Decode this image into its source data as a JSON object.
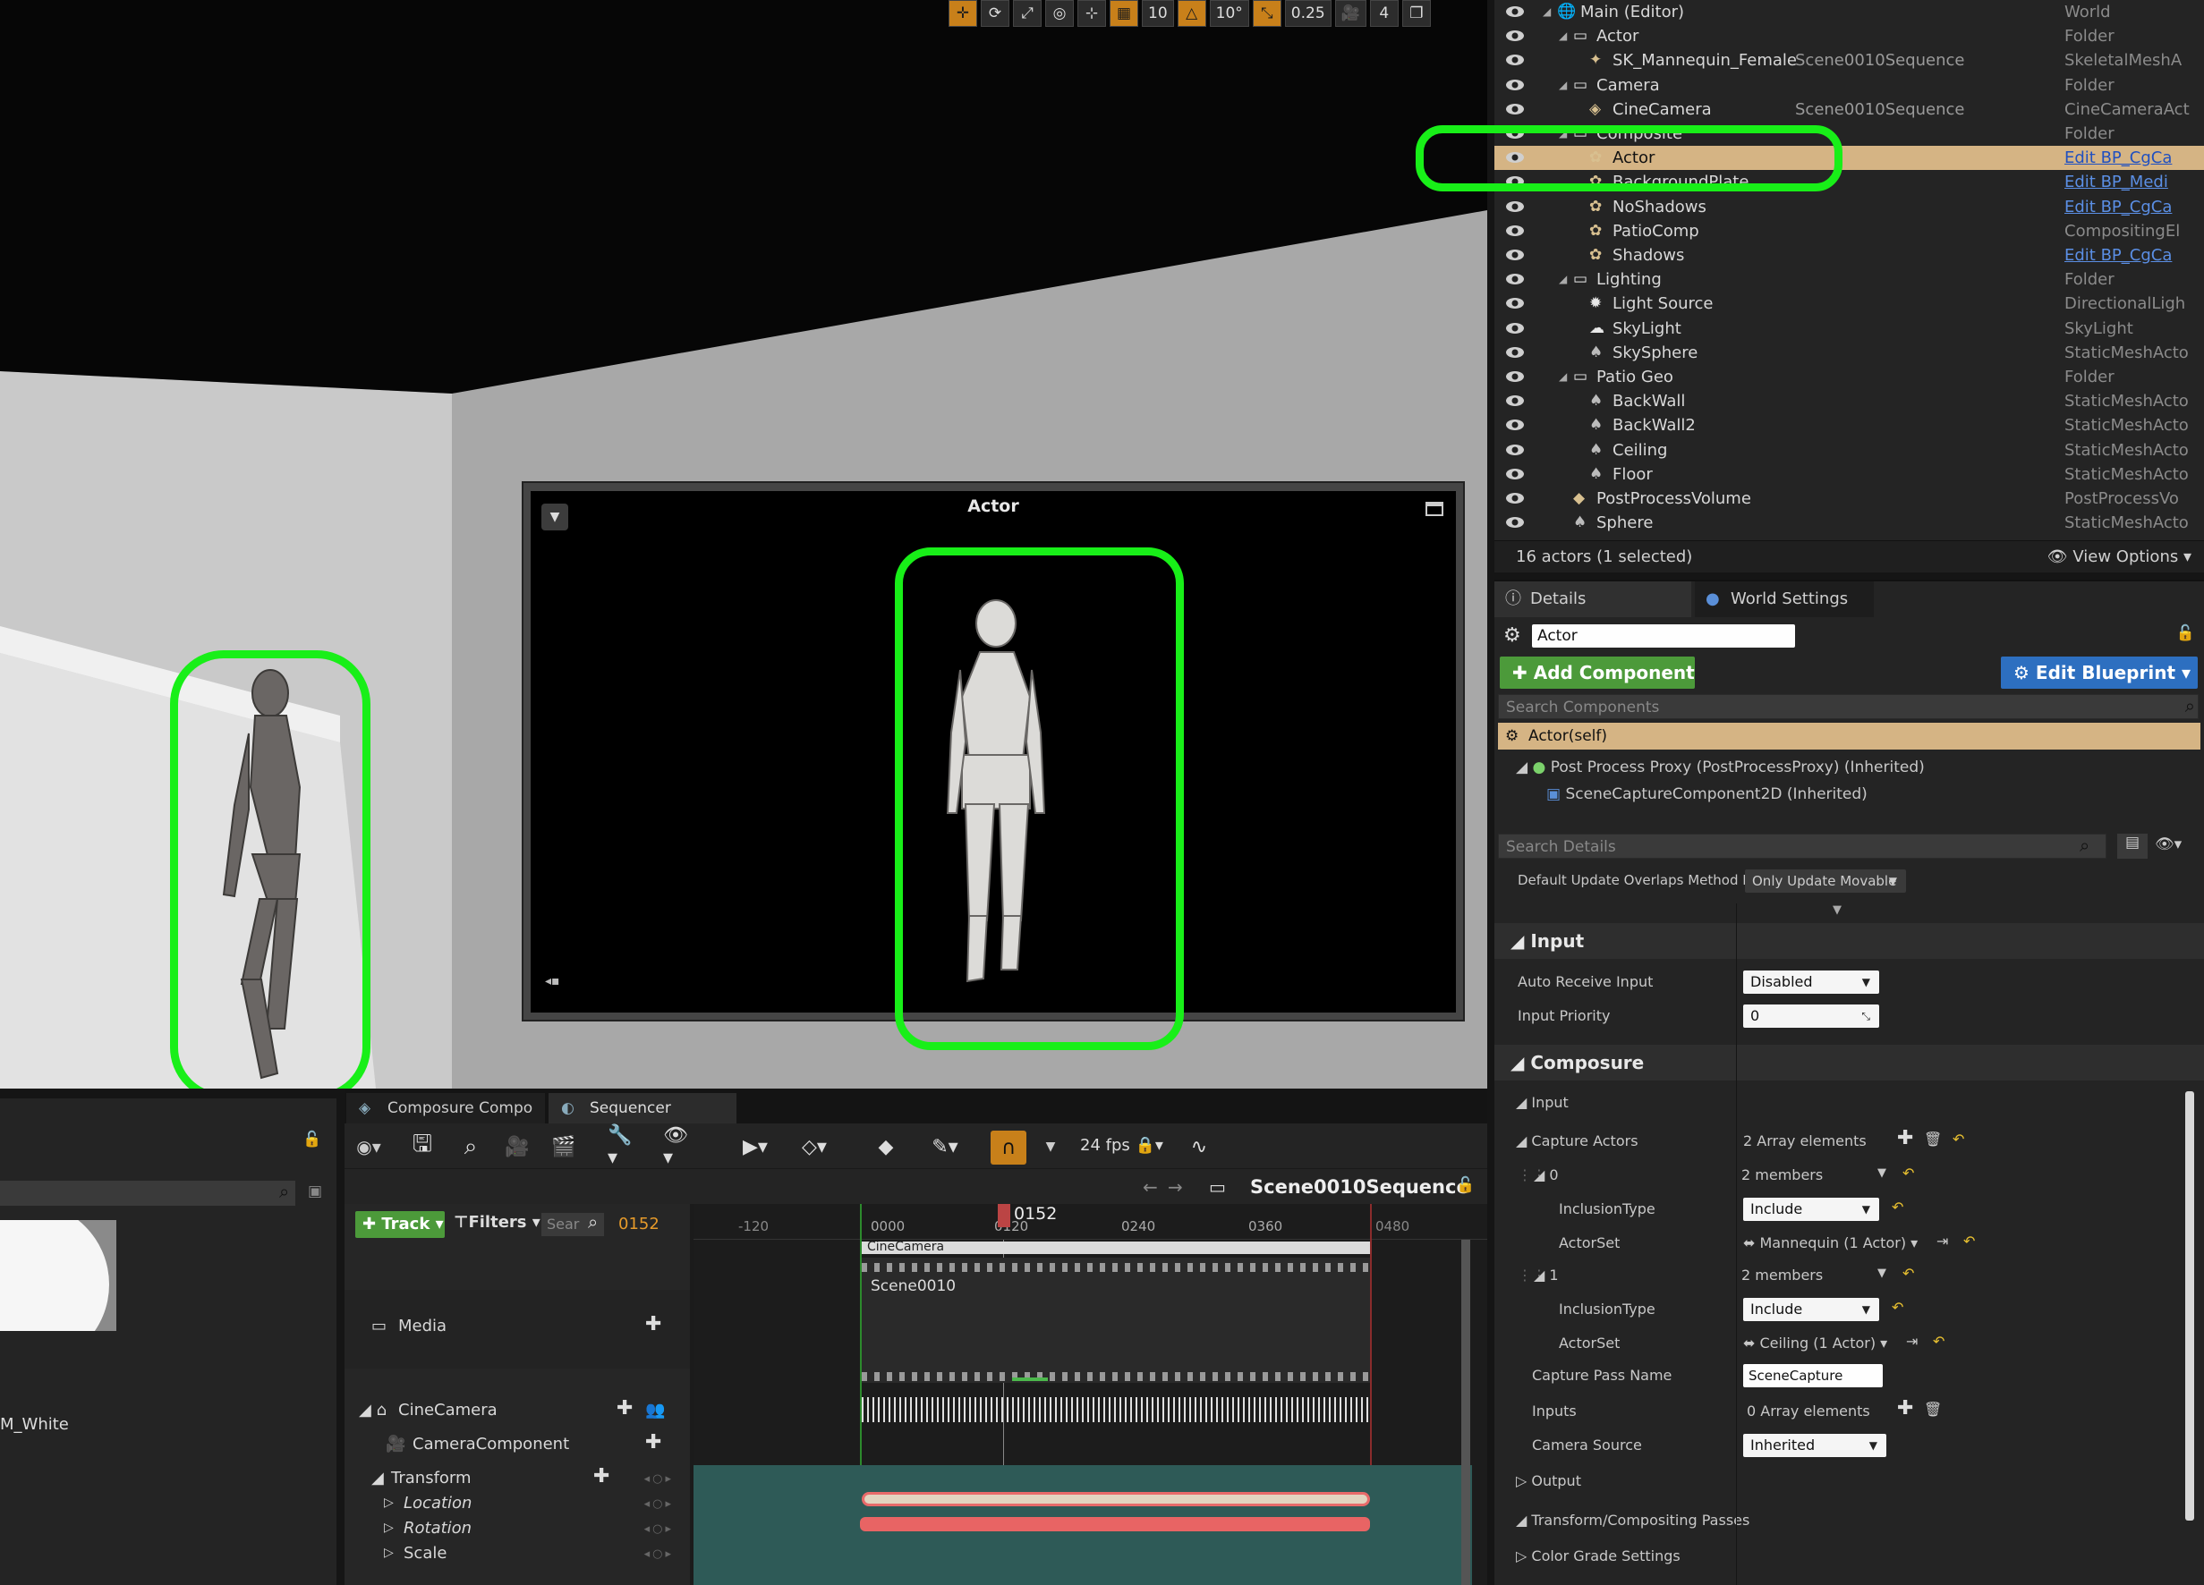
{
  "viewport": {
    "toolbar": {
      "grid_snap": "10",
      "rotation_snap": "10°",
      "scale_snap": "0.25",
      "camera_speed": "4"
    },
    "pip": {
      "title": "Actor"
    }
  },
  "outliner": {
    "rows": [
      {
        "name": "Main (Editor)",
        "level": "",
        "type": "World",
        "indent": 0,
        "icon": "world-icon",
        "expanded": true
      },
      {
        "name": "Actor",
        "level": "",
        "type": "Folder",
        "indent": 1,
        "icon": "folder-icon",
        "expanded": true
      },
      {
        "name": "SK_Mannequin_Female",
        "level": "Scene0010Sequence",
        "type": "SkeletalMeshA",
        "indent": 2,
        "icon": "skeletal-mesh-icon"
      },
      {
        "name": "Camera",
        "level": "",
        "type": "Folder",
        "indent": 1,
        "icon": "folder-icon",
        "expanded": true
      },
      {
        "name": "CineCamera",
        "level": "Scene0010Sequence",
        "type": "CineCameraAct",
        "indent": 2,
        "icon": "camera-icon"
      },
      {
        "name": "Composite",
        "level": "",
        "type": "Folder",
        "indent": 1,
        "icon": "folder-icon",
        "expanded": true
      },
      {
        "name": "Actor",
        "level": "",
        "type": "Edit BP_CgCa",
        "indent": 2,
        "icon": "actor-icon",
        "selected": true,
        "link": true
      },
      {
        "name": "BackgroundPlate",
        "level": "",
        "type": "Edit BP_Medi",
        "indent": 2,
        "icon": "actor-icon",
        "link": true
      },
      {
        "name": "NoShadows",
        "level": "",
        "type": "Edit BP_CgCa",
        "indent": 2,
        "icon": "actor-icon",
        "link": true
      },
      {
        "name": "PatioComp",
        "level": "",
        "type": "CompositingEl",
        "indent": 2,
        "icon": "actor-icon"
      },
      {
        "name": "Shadows",
        "level": "",
        "type": "Edit BP_CgCa",
        "indent": 2,
        "icon": "actor-icon",
        "link": true
      },
      {
        "name": "Lighting",
        "level": "",
        "type": "Folder",
        "indent": 1,
        "icon": "folder-icon",
        "expanded": true
      },
      {
        "name": "Light Source",
        "level": "",
        "type": "DirectionalLigh",
        "indent": 2,
        "icon": "sun-icon"
      },
      {
        "name": "SkyLight",
        "level": "",
        "type": "SkyLight",
        "indent": 2,
        "icon": "skylight-icon"
      },
      {
        "name": "SkySphere",
        "level": "",
        "type": "StaticMeshActo",
        "indent": 2,
        "icon": "static-mesh-icon"
      },
      {
        "name": "Patio Geo",
        "level": "",
        "type": "Folder",
        "indent": 1,
        "icon": "folder-icon",
        "expanded": true
      },
      {
        "name": "BackWall",
        "level": "",
        "type": "StaticMeshActo",
        "indent": 2,
        "icon": "static-mesh-icon"
      },
      {
        "name": "BackWall2",
        "level": "",
        "type": "StaticMeshActo",
        "indent": 2,
        "icon": "static-mesh-icon"
      },
      {
        "name": "Ceiling",
        "level": "",
        "type": "StaticMeshActo",
        "indent": 2,
        "icon": "static-mesh-icon"
      },
      {
        "name": "Floor",
        "level": "",
        "type": "StaticMeshActo",
        "indent": 2,
        "icon": "static-mesh-icon"
      },
      {
        "name": "PostProcessVolume",
        "level": "",
        "type": "PostProcessVo",
        "indent": 1,
        "icon": "postprocess-icon"
      },
      {
        "name": "Sphere",
        "level": "",
        "type": "StaticMeshActo",
        "indent": 1,
        "icon": "static-mesh-icon"
      }
    ],
    "footer": {
      "count": "16 actors (1 selected)",
      "view_options": "View Options"
    }
  },
  "details": {
    "tabs": [
      {
        "label": "Details"
      },
      {
        "label": "World Settings"
      }
    ],
    "actor_name": "Actor",
    "add_component": "Add Component",
    "edit_blueprint": "Edit Blueprint",
    "search_components_placeholder": "Search Components",
    "components": [
      {
        "label": "Actor(self)"
      },
      {
        "label": "Post Process Proxy (PostProcessProxy) (Inherited)"
      },
      {
        "label": "SceneCaptureComponent2D (Inherited)"
      }
    ],
    "search_details_placeholder": "Search Details",
    "update_overlaps_label": "Default Update Overlaps Method D",
    "update_overlaps_value": "Only Update Movable",
    "input_category": "Input",
    "auto_receive_input_label": "Auto Receive Input",
    "auto_receive_input_value": "Disabled",
    "input_priority_label": "Input Priority",
    "input_priority_value": "0",
    "composure_category": "Composure",
    "composure_input": "Input",
    "capture_actors_label": "Capture Actors",
    "capture_actors_value": "2 Array elements",
    "item0_label": "0",
    "item0_value": "2 members",
    "inclusion_type_label": "InclusionType",
    "inclusion0_value": "Include",
    "actor_set_label": "ActorSet",
    "actorset0_value": "Mannequin (1 Actor)",
    "item1_label": "1",
    "item1_value": "2 members",
    "inclusion1_value": "Include",
    "actorset1_value": "Ceiling (1 Actor)",
    "capture_pass_label": "Capture Pass Name",
    "capture_pass_value": "SceneCapture",
    "inputs_label": "Inputs",
    "inputs_value": "0 Array elements",
    "camera_source_label": "Camera Source",
    "camera_source_value": "Inherited",
    "output_label": "Output",
    "transform_label": "Transform/Compositing Passes",
    "color_grade_label": "Color Grade Settings"
  },
  "content_browser": {
    "asset_name": "M_White"
  },
  "sequencer": {
    "tabs": [
      {
        "label": "Composure Compo"
      },
      {
        "label": "Sequencer"
      }
    ],
    "fps": "24 fps",
    "sequence_name": "Scene0010Sequence",
    "track_button": "Track",
    "filters_button": "Filters",
    "search_placeholder": "Sear",
    "current_frame": "0152",
    "ruler": [
      "-120",
      "0000",
      "0120",
      "0240",
      "0360",
      "0480"
    ],
    "tracks": {
      "media": "Media",
      "cinecamera": "CineCamera",
      "camera_component": "CameraComponent",
      "transform": "Transform",
      "location": "Location",
      "rotation": "Rotation",
      "scale": "Scale"
    },
    "sections": {
      "camera_cut": "CineCamera",
      "media_section": "Scene0010"
    }
  },
  "colors": {
    "highlight": "#18ef18",
    "selection": "#d5b484",
    "accent_orange": "#c8801a",
    "add_green": "#4c9a3a",
    "blueprint_blue": "#2d6fc0"
  }
}
